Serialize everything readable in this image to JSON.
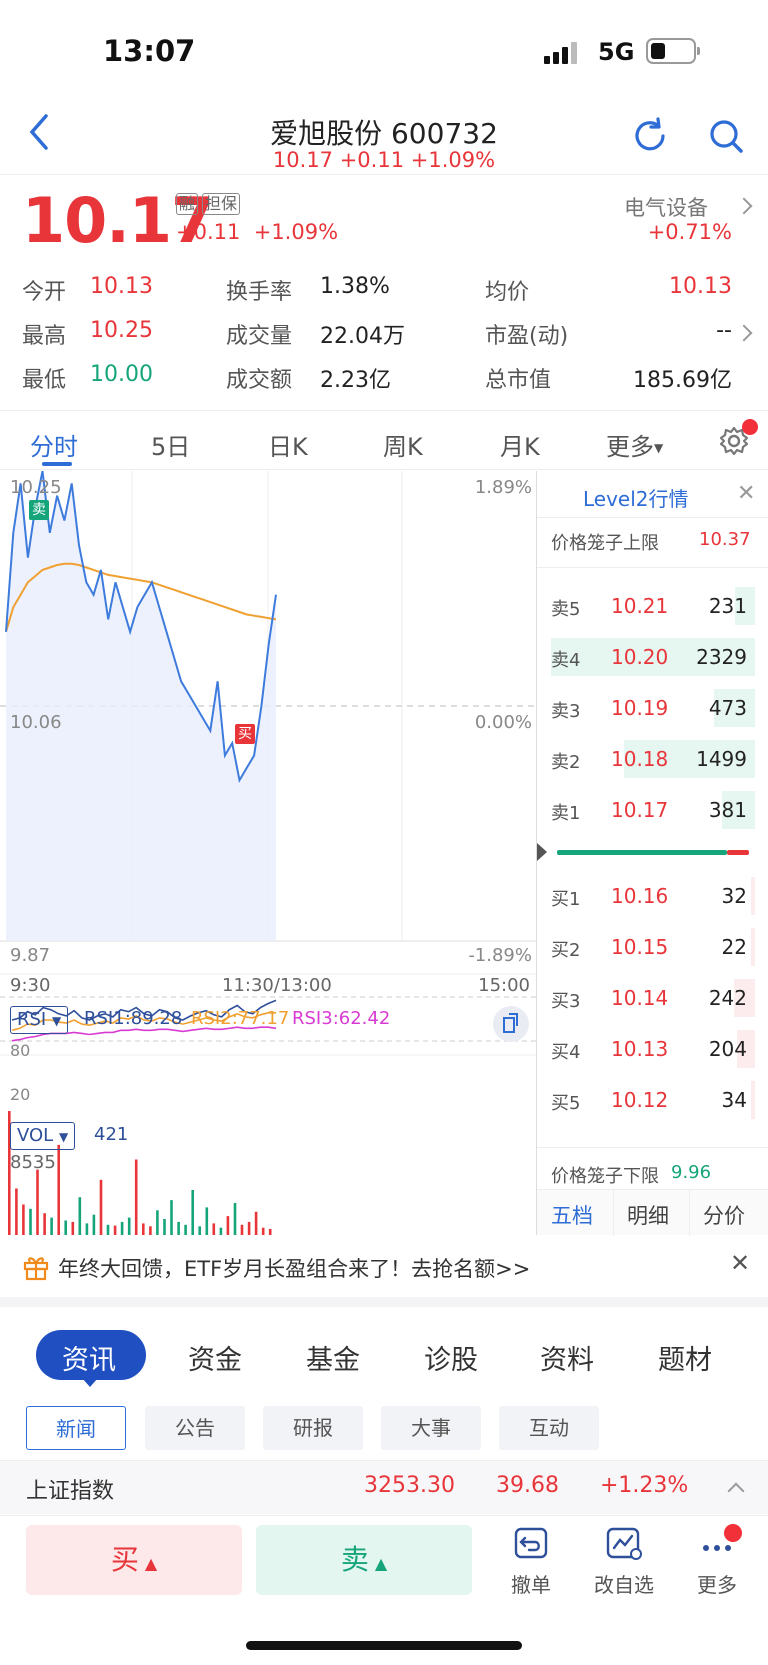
{
  "status": {
    "time": "13:07",
    "network": "5G"
  },
  "header": {
    "title": "爱旭股份 600732",
    "subtitle": "10.17 +0.11 +1.09%"
  },
  "quote": {
    "price": "10.17",
    "change": "+0.11",
    "change_pct": "+1.09%",
    "tags": [
      "融",
      "担保"
    ],
    "sector": "电气设备",
    "sector_chg": "+0.71%",
    "stats": [
      {
        "label": "今开",
        "value": "10.13",
        "color": "red"
      },
      {
        "label": "换手率",
        "value": "1.38%"
      },
      {
        "label": "均价",
        "value": "10.13",
        "color": "red"
      },
      {
        "label": "最高",
        "value": "10.25",
        "color": "red"
      },
      {
        "label": "成交量",
        "value": "22.04万"
      },
      {
        "label": "市盈(动)",
        "value": "--"
      },
      {
        "label": "最低",
        "value": "10.00",
        "color": "green"
      },
      {
        "label": "成交额",
        "value": "2.23亿"
      },
      {
        "label": "总市值",
        "value": "185.69亿"
      }
    ]
  },
  "tabs": [
    "分时",
    "5日",
    "日K",
    "周K",
    "月K",
    "更多"
  ],
  "chart": {
    "y_top": "10.25",
    "y_mid": "10.06",
    "y_bot": "9.87",
    "pct_top": "1.89%",
    "pct_mid": "0.00%",
    "pct_bot": "-1.89%",
    "t0": "9:30",
    "tmid": "11:30/13:00",
    "tend": "15:00",
    "sell_mark": "卖",
    "buy_mark": "买",
    "rsi": {
      "name": "RSI",
      "rsi1": "RSI1:89.28",
      "rsi2": "RSI2:77.17",
      "rsi3": "RSI3:62.42",
      "level80": "80",
      "level20": "20"
    },
    "vol": {
      "name": "VOL",
      "value": "421",
      "max": "8535"
    }
  },
  "chart_data": {
    "type": "line",
    "ylim": [
      9.87,
      10.25
    ],
    "price": [
      10.12,
      10.2,
      10.24,
      10.18,
      10.22,
      10.25,
      10.2,
      10.23,
      10.21,
      10.24,
      10.19,
      10.16,
      10.15,
      10.17,
      10.13,
      10.16,
      10.14,
      10.12,
      10.14,
      10.15,
      10.16,
      10.14,
      10.12,
      10.1,
      10.08,
      10.07,
      10.06,
      10.05,
      10.04,
      10.08,
      10.02,
      10.03,
      10.0,
      10.01,
      10.02,
      10.06,
      10.11,
      10.15
    ],
    "avg": [
      10.12,
      10.14,
      10.15,
      10.16,
      10.165,
      10.17,
      10.172,
      10.174,
      10.175,
      10.175,
      10.174,
      10.172,
      10.17,
      10.168,
      10.166,
      10.165,
      10.164,
      10.163,
      10.162,
      10.161,
      10.16,
      10.158,
      10.156,
      10.154,
      10.152,
      10.15,
      10.148,
      10.146,
      10.144,
      10.142,
      10.14,
      10.138,
      10.136,
      10.134,
      10.133,
      10.132,
      10.131,
      10.13
    ],
    "rsi1": [
      70,
      72,
      78,
      75,
      82,
      80,
      76,
      74,
      79,
      72,
      70,
      74,
      76,
      73,
      80,
      78,
      82,
      76,
      74,
      80,
      78,
      72,
      70,
      74,
      77,
      79,
      75,
      73,
      80,
      84,
      78,
      76,
      82,
      86,
      89
    ],
    "rsi2": [
      60,
      62,
      66,
      65,
      70,
      70,
      68,
      67,
      70,
      66,
      65,
      67,
      69,
      67,
      72,
      71,
      74,
      70,
      69,
      72,
      71,
      68,
      66,
      68,
      70,
      72,
      70,
      69,
      73,
      76,
      73,
      72,
      75,
      77,
      77
    ],
    "rsi3": [
      50,
      51,
      53,
      54,
      56,
      57,
      57,
      57,
      58,
      57,
      56,
      57,
      58,
      58,
      60,
      60,
      61,
      60,
      60,
      61,
      61,
      60,
      59,
      60,
      61,
      62,
      61,
      61,
      62,
      63,
      62,
      62,
      63,
      63,
      62
    ],
    "volume": [
      8535,
      3200,
      2100,
      1800,
      4500,
      1500,
      1200,
      6200,
      1000,
      900,
      2600,
      800,
      1400,
      3800,
      700,
      650,
      900,
      1200,
      5200,
      800,
      600,
      1700,
      1100,
      2400,
      900,
      700,
      3100,
      600,
      1900,
      800,
      500,
      1300,
      2200,
      700,
      900,
      1600,
      500,
      421
    ]
  },
  "orderbook": {
    "title": "Level2行情",
    "upper_label": "价格笼子上限",
    "upper": "10.37",
    "lower_label": "价格笼子下限",
    "lower": "9.96",
    "asks": [
      {
        "label": "卖5",
        "price": "10.21",
        "vol": "231"
      },
      {
        "label": "卖4",
        "price": "10.20",
        "vol": "2329"
      },
      {
        "label": "卖3",
        "price": "10.19",
        "vol": "473"
      },
      {
        "label": "卖2",
        "price": "10.18",
        "vol": "1499"
      },
      {
        "label": "卖1",
        "price": "10.17",
        "vol": "381"
      }
    ],
    "bids": [
      {
        "label": "买1",
        "price": "10.16",
        "vol": "32"
      },
      {
        "label": "买2",
        "price": "10.15",
        "vol": "22"
      },
      {
        "label": "买3",
        "price": "10.14",
        "vol": "242"
      },
      {
        "label": "买4",
        "price": "10.13",
        "vol": "204"
      },
      {
        "label": "买5",
        "price": "10.12",
        "vol": "34"
      }
    ],
    "tabs": [
      "五档",
      "明细",
      "分价"
    ]
  },
  "banner": {
    "text": "年终大回馈，ETF岁月长盈组合来了！去抢名额>>"
  },
  "categories": [
    "资讯",
    "资金",
    "基金",
    "诊股",
    "资料",
    "题材"
  ],
  "subtabs": [
    "新闻",
    "公告",
    "研报",
    "大事",
    "互动"
  ],
  "index": {
    "name": "上证指数",
    "value": "3253.30",
    "change": "39.68",
    "pct": "+1.23%"
  },
  "bottom": {
    "buy": "买",
    "sell": "卖",
    "tools": [
      "撤单",
      "改自选",
      "更多"
    ]
  },
  "colors": {
    "up": "#e8353a",
    "down": "#16a57a",
    "accent": "#2e6cd6"
  }
}
